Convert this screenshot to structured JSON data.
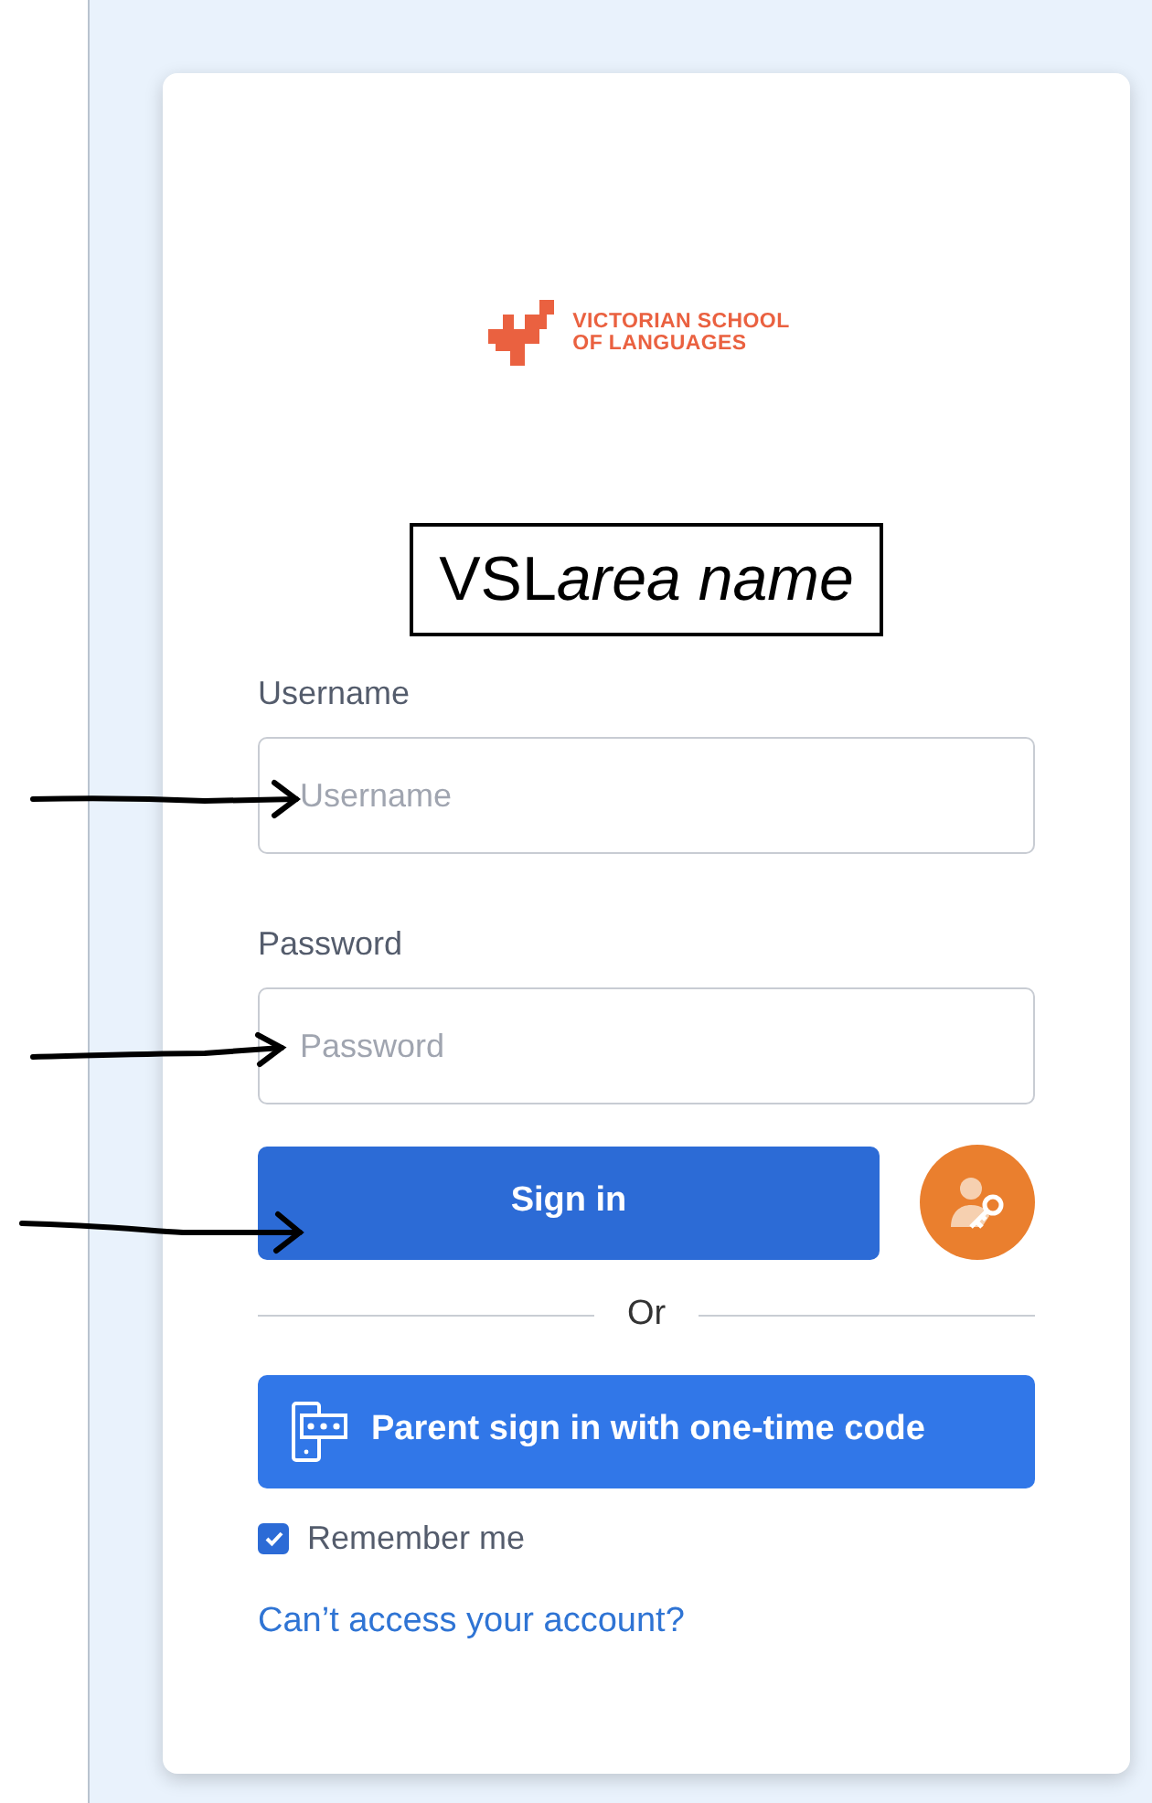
{
  "logo": {
    "line_1": "VICTORIAN SCHOOL",
    "line_2": "OF LANGUAGES"
  },
  "annotation": {
    "prefix": "VSL",
    "name": "area name"
  },
  "username": {
    "label": "Username",
    "placeholder": "Username"
  },
  "password": {
    "label": "Password",
    "placeholder": "Password"
  },
  "sign_in_button": "Sign in",
  "divider": "Or",
  "parent_button": "Parent sign in with one-time code",
  "remember_me": {
    "label": "Remember me",
    "checked": true
  },
  "help_link": "Can’t access your account?"
}
